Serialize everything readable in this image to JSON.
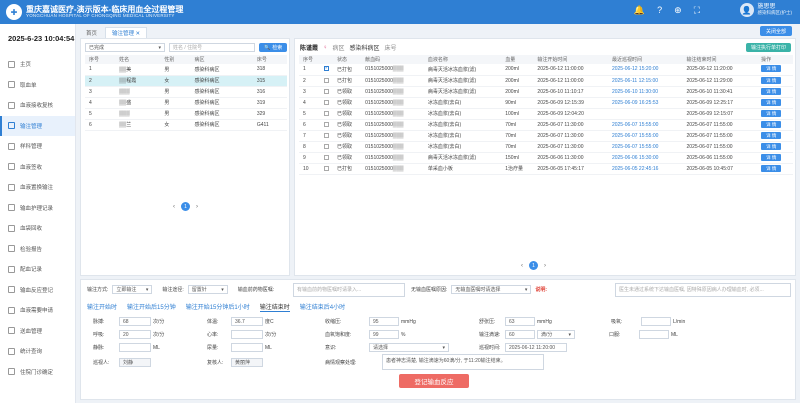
{
  "header": {
    "title": "重庆嘉诚医疗-演示版本-临床用血全过程管理",
    "subtitle": "YONGCHUAN HOSPITAL OF CHONGQING MEDICAL UNIVERSITY",
    "user_name": "施思思",
    "user_dept": "感染科病区(护士)"
  },
  "sidebar": {
    "datetime": "2025-6-23 10:04:54",
    "items": [
      {
        "label": "主页",
        "icon": "home-icon"
      },
      {
        "label": "取血单",
        "icon": "form-icon"
      },
      {
        "label": "血液接收复核",
        "icon": "receive-icon"
      },
      {
        "label": "输注管理",
        "icon": "infusion-icon"
      },
      {
        "label": "样科管理",
        "icon": "sample-icon"
      },
      {
        "label": "血液签收",
        "icon": "sign-icon"
      },
      {
        "label": "血液置换输注",
        "icon": "exchange-icon"
      },
      {
        "label": "输血护理记录",
        "icon": "record-icon"
      },
      {
        "label": "血袋回收",
        "icon": "recycle-icon"
      },
      {
        "label": "检验报告",
        "icon": "report-icon"
      },
      {
        "label": "配血记录",
        "icon": "match-icon"
      },
      {
        "label": "输血反应登记",
        "icon": "reaction-icon"
      },
      {
        "label": "血液需要申请",
        "icon": "apply-icon"
      },
      {
        "label": "送血管理",
        "icon": "delivery-icon"
      },
      {
        "label": "统计查询",
        "icon": "stats-icon"
      },
      {
        "label": "住院门诊确定",
        "icon": "hospital-icon"
      }
    ],
    "active_index": 3
  },
  "tabs": [
    {
      "label": "首页",
      "active": false
    },
    {
      "label": "输注管理 ✕",
      "active": true
    }
  ],
  "close_other": "关闭全部",
  "left": {
    "filter_value": "已完成",
    "search_placeholder": "姓名 / 住院号",
    "search_button": "检索",
    "columns": [
      "序号",
      "姓名",
      "性别",
      "病区",
      "床号"
    ],
    "rows": [
      [
        "1",
        "▒▒美",
        "男",
        "感染科病区",
        "318"
      ],
      [
        "2",
        "▒▒程霞",
        "女",
        "感染科病区",
        "315"
      ],
      [
        "3",
        "▒▒▒",
        "男",
        "感染科病区",
        "316"
      ],
      [
        "4",
        "▒▒盛",
        "男",
        "感染科病区",
        "319"
      ],
      [
        "5",
        "▒▒▒",
        "男",
        "感染科病区",
        "329"
      ],
      [
        "6",
        "▒▒兰",
        "女",
        "感染科病区",
        "G411"
      ]
    ],
    "selected_row": 1,
    "page": "1"
  },
  "right": {
    "patient_name": "陈谨霞",
    "patient_sex": "♀",
    "dept_label": "病区",
    "dept_value": "感染科病区",
    "bed_label": "床号",
    "print_button": "输注执行单打印",
    "columns": [
      "序号",
      "",
      "状态",
      "献血码",
      "血液名称",
      "血量",
      "输注开始时间",
      "最近巡视时间",
      "输注结束时间",
      "操作"
    ],
    "rows": [
      [
        "1",
        true,
        "已打包",
        "0151025000▒▒▒",
        "病毒灭活冰冻血浆(滤)",
        "200ml",
        "2025-06-12 11:00:00",
        "2025-06-12 15:20:00",
        "2025-06-12 11:20:00",
        "详 情"
      ],
      [
        "2",
        false,
        "已打包",
        "0151025000▒▒▒",
        "病毒灭活冰冻血浆(滤)",
        "200ml",
        "2025-06-12 11:00:00",
        "2025-06-11 12:15:00",
        "2025-06-12 11:29:00",
        "详 情"
      ],
      [
        "3",
        false,
        "已领取",
        "0151025000▒▒▒",
        "病毒灭活冰冻血浆(滤)",
        "200ml",
        "2025-06-10 11:10:17",
        "2025-06-10 11:30:00",
        "2025-06-10 11:30:41",
        "详 情"
      ],
      [
        "4",
        false,
        "已领取",
        "0151025000▒▒▒",
        "冰冻血浆(去白)",
        "90ml",
        "2025-06-09 12:15:39",
        "2025-06-09 16:25:53",
        "2025-06-09 12:25:17",
        "详 情"
      ],
      [
        "5",
        false,
        "已领取",
        "0151025000▒▒▒",
        "冰冻血浆(去白)",
        "100ml",
        "2025-06-09 12:04:20",
        "",
        "2025-06-09 12:15:07",
        "详 情"
      ],
      [
        "6",
        false,
        "已领取",
        "0151025000▒▒▒",
        "冰冻血浆(去白)",
        "70ml",
        "2025-06-07 11:30:00",
        "2025-06-07 15:55:00",
        "2025-06-07 11:55:00",
        "详 情"
      ],
      [
        "7",
        false,
        "已领取",
        "0151025000▒▒▒",
        "冰冻血浆(去白)",
        "70ml",
        "2025-06-07 11:30:00",
        "2025-06-07 15:55:00",
        "2025-06-07 11:55:00",
        "详 情"
      ],
      [
        "8",
        false,
        "已领取",
        "0151025000▒▒▒",
        "冰冻血浆(去白)",
        "70ml",
        "2025-06-07 11:30:00",
        "2025-06-07 15:55:00",
        "2025-06-07 11:55:00",
        "详 情"
      ],
      [
        "9",
        false,
        "已领取",
        "0151025000▒▒▒",
        "病毒灭活冰冻血浆(滤)",
        "150ml",
        "2025-06-06 11:30:00",
        "2025-06-06 15:30:00",
        "2025-06-06 11:55:00",
        "详 情"
      ],
      [
        "10",
        false,
        "已打包",
        "0151025000▒▒▒",
        "单采血小板",
        "1治疗量",
        "2025-06-05 17:45:17",
        "2025-06-05 22:45:16",
        "2025-06-05 10:45:07",
        "详 情"
      ]
    ],
    "page": "1"
  },
  "form": {
    "method_label": "输注方式:",
    "method_value": "立即输注",
    "route_label": "输注途径:",
    "route_value": "留置针",
    "before_drug_label": "输血前药物医嘱:",
    "before_drug_placeholder": "有输血前药物医嘱时请录入...",
    "reaction_label": "无输血医嘱原因:",
    "reaction_value": "无输血医嘱时请选择",
    "note_label": "说明:",
    "note_placeholder": "医生未通过系统下达输血医嘱, 因特殊原因病人办理输血时, 必须...",
    "subtabs": [
      "输注开始时",
      "输注开始后15分钟",
      "输注开始15分钟后1小时",
      "输注结束时",
      "输注结束后4小时"
    ],
    "active_subtab": 3,
    "pulse_label": "脉搏:",
    "pulse_value": "68",
    "pulse_unit": "次/分",
    "temp_label": "体温:",
    "temp_value": "36.7",
    "temp_unit": "度C",
    "sbp_label": "收缩压:",
    "sbp_value": "95",
    "sbp_unit": "mmHg",
    "dbp_label": "舒张压:",
    "dbp_value": "63",
    "dbp_unit": "mmHg",
    "oxy_label": "吸氧:",
    "oxy_unit": "L/min",
    "resp_label": "呼吸:",
    "resp_value": "20",
    "resp_unit": "次/分",
    "hr_label": "心率:",
    "hr_unit": "次/分",
    "spo2_label": "血氧饱和度:",
    "spo2_value": "99",
    "spo2_unit": "%",
    "speed_label": "输注滴速:",
    "speed_value": "60",
    "speed_unit": "滴/分",
    "urine_label": "口服:",
    "urine_unit": "ML",
    "iv_label": "静脉:",
    "iv_unit": "ML",
    "output_label": "尿量:",
    "output_unit": "ML",
    "conscious_label": "意识:",
    "conscious_value": "请选择",
    "visit_time_label": "巡视时间:",
    "visit_time_value": "2025-06-12 11:20:00",
    "patrol_label": "巡视人:",
    "patrol_value": "刘静",
    "checker_label": "复核人:",
    "checker_value": "黄丽萍",
    "observe_label": "病情观察处理:",
    "observe_value": "患者神志清楚, 输注滴速为60滴/分, 于11:20输注结束。",
    "submit": "登记输血反应"
  }
}
